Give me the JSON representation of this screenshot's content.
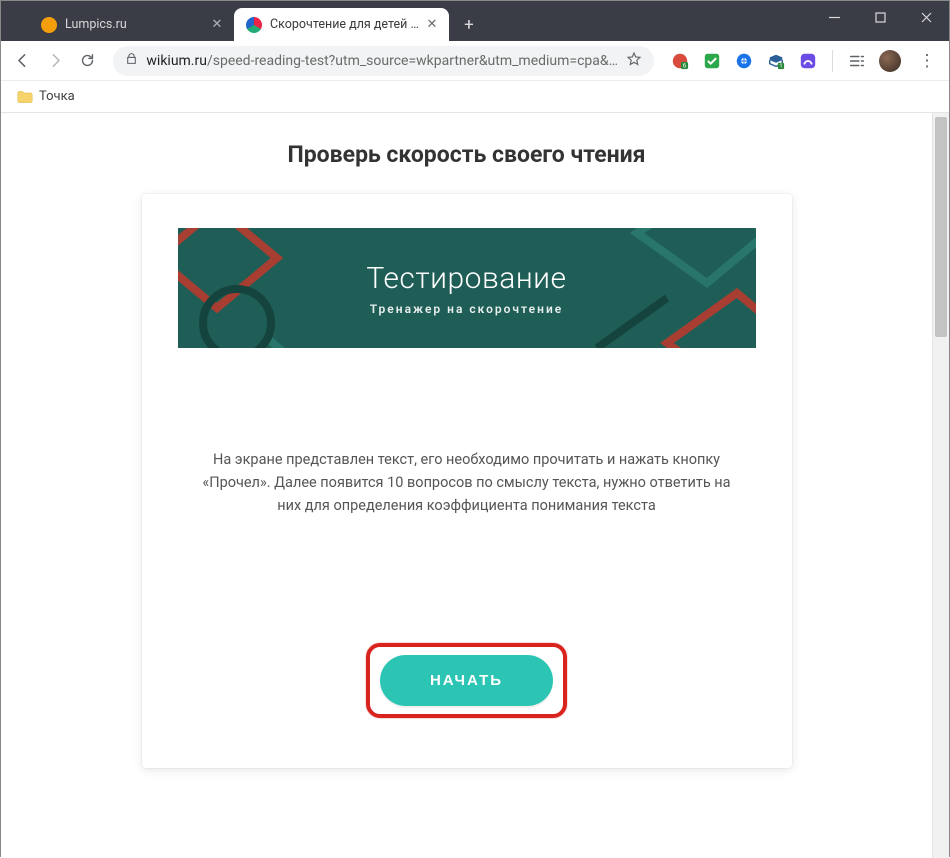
{
  "window": {
    "tabs": [
      {
        "label": "Lumpics.ru",
        "active": false
      },
      {
        "label": "Скорочтение для детей и взрос",
        "active": true
      }
    ],
    "newtab_label": "+",
    "controls": {
      "min": "-",
      "max": "□",
      "close": "×"
    }
  },
  "toolbar": {
    "url_host": "wikium.ru",
    "url_path": "/speed-reading-test?utm_source=wkpartner&utm_medium=cpa&…"
  },
  "bookmarks": {
    "items": [
      {
        "label": "Точка"
      }
    ]
  },
  "page": {
    "title": "Проверь скорость своего чтения",
    "banner": {
      "title": "Тестирование",
      "subtitle": "Тренажер на скорочтение"
    },
    "instructions": "На экране представлен текст, его необходимо прочитать и нажать кнопку «Прочел». Далее появится 10 вопросов по смыслу текста, нужно ответить на них для определения коэффициента понимания текста",
    "cta_label": "НАЧАТЬ"
  }
}
